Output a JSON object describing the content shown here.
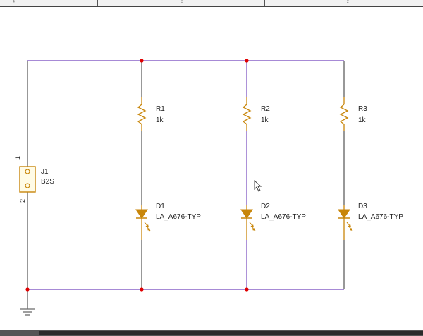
{
  "ruler": {
    "zones": [
      "4",
      "3",
      "2"
    ]
  },
  "connector": {
    "ref": "J1",
    "value": "B2S",
    "pin1": "1",
    "pin2": "2"
  },
  "resistors": [
    {
      "ref": "R1",
      "value": "1k"
    },
    {
      "ref": "R2",
      "value": "1k"
    },
    {
      "ref": "R3",
      "value": "1k"
    }
  ],
  "leds": [
    {
      "ref": "D1",
      "value": "LA_A676-TYP"
    },
    {
      "ref": "D2",
      "value": "LA_A676-TYP"
    },
    {
      "ref": "D3",
      "value": "LA_A676-TYP"
    }
  ],
  "colors": {
    "wire": "#6b6b6b",
    "wire_highlight": "#8a63c8",
    "part": "#c8860a",
    "junction": "#e00000"
  }
}
